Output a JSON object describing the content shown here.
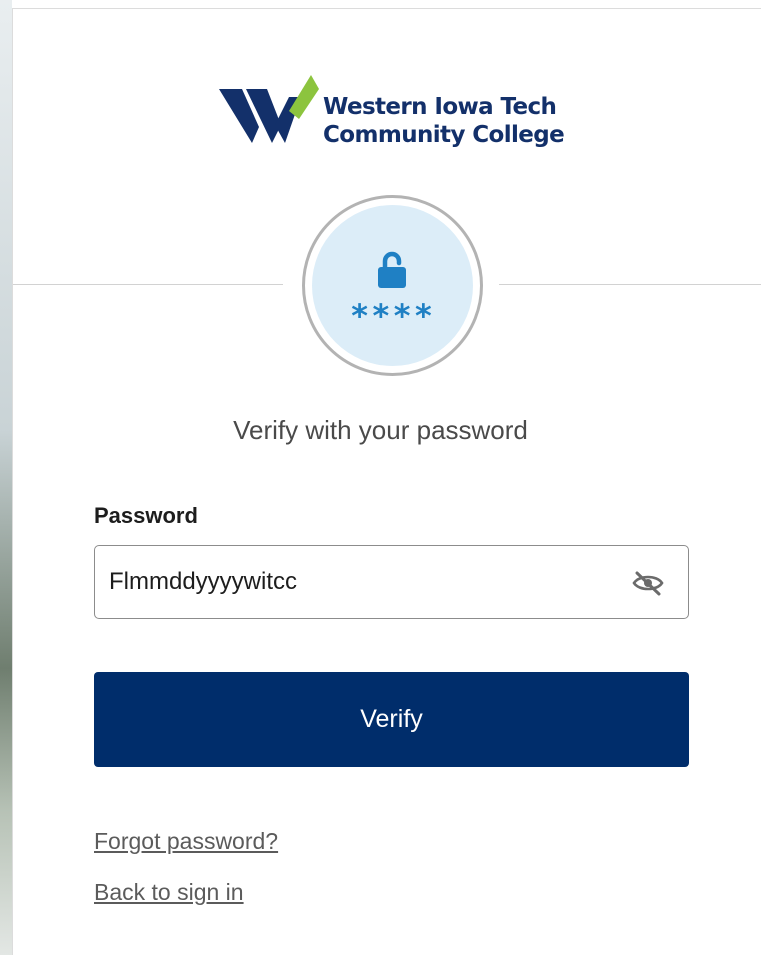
{
  "logo": {
    "line1": "Western Iowa Tech",
    "line2": "Community College",
    "colors": {
      "navy": "#13306a",
      "green": "#8cc43e"
    }
  },
  "badge": {
    "icon": "padlock-unlocked-icon",
    "stars": "****",
    "color": "#1f80c4",
    "background": "#dcedf8"
  },
  "heading": "Verify with your password",
  "password": {
    "label": "Password",
    "value": "Flmmddyyyywitcc",
    "toggle_icon": "eye-slash-icon"
  },
  "verify_button": {
    "label": "Verify",
    "color": "#002d6b"
  },
  "links": {
    "forgot": "Forgot password?",
    "back": "Back to sign in"
  }
}
